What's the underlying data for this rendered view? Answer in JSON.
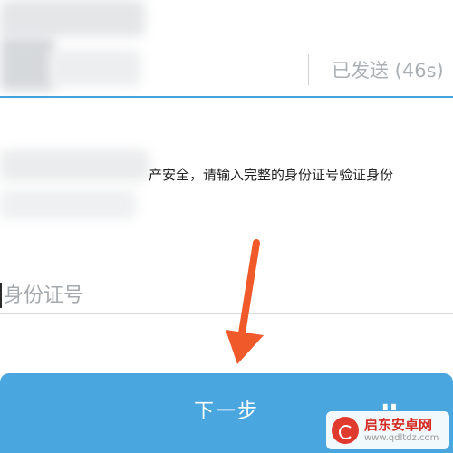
{
  "verification": {
    "sent_status": "已发送 (46s)"
  },
  "instruction": {
    "text": "产安全，请输入完整的身份证号验证身份"
  },
  "id_field": {
    "value": "",
    "placeholder": "身份证号"
  },
  "next_button": {
    "label": "下一步"
  },
  "colors": {
    "accent": "#4aa6df",
    "arrow": "#f05a2a"
  },
  "watermark": {
    "title": "启东安卓网",
    "url": "www.qdltdz.com"
  }
}
